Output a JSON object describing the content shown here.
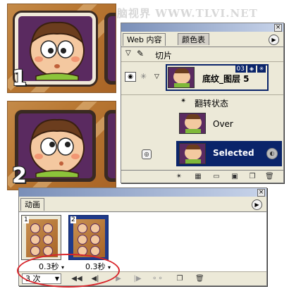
{
  "watermark": "电脑视界 WWW.TLVI.NET",
  "tiles": [
    {
      "number": "1"
    },
    {
      "number": "2"
    }
  ],
  "layers_panel": {
    "tabs": [
      "Web 内容",
      "颜色表"
    ],
    "slice_header": "切片",
    "layer_name": "底纹_图层 5",
    "layer_badge": "03",
    "rollover_label": "翻转状态",
    "states": [
      {
        "label": "Over",
        "selected": false
      },
      {
        "label": "Selected",
        "selected": true
      }
    ]
  },
  "animation_panel": {
    "tab": "动画",
    "frames": [
      {
        "index": "1",
        "delay": "0.3秒",
        "selected": false
      },
      {
        "index": "2",
        "delay": "0.3秒",
        "selected": true
      }
    ],
    "loop_value": "3 次"
  },
  "colors": {
    "highlight_ellipse": "#d8242a",
    "selection": "#0a246a"
  }
}
